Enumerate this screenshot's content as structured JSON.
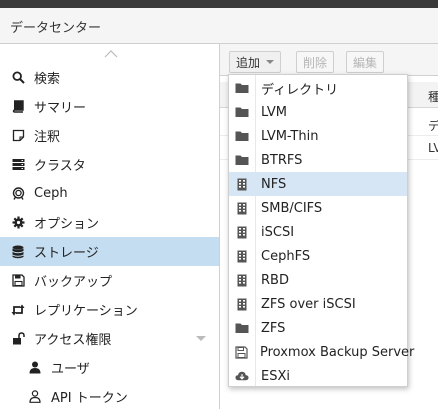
{
  "header": {
    "title": "データセンター"
  },
  "sidebar": {
    "items": [
      {
        "label": "検索",
        "icon": "search-icon"
      },
      {
        "label": "サマリー",
        "icon": "book-icon"
      },
      {
        "label": "注釈",
        "icon": "note-icon"
      },
      {
        "label": "クラスタ",
        "icon": "server-icon"
      },
      {
        "label": "Ceph",
        "icon": "ceph-icon"
      },
      {
        "label": "オプション",
        "icon": "gear-icon"
      },
      {
        "label": "ストレージ",
        "icon": "database-icon"
      },
      {
        "label": "バックアップ",
        "icon": "floppy-icon"
      },
      {
        "label": "レプリケーション",
        "icon": "retweet-icon"
      },
      {
        "label": "アクセス権限",
        "icon": "unlock-icon"
      },
      {
        "label": "ユーザ",
        "icon": "user-icon"
      },
      {
        "label": "API トークン",
        "icon": "user-outline-icon"
      }
    ],
    "selected_index": 6
  },
  "toolbar": {
    "add_label": "追加",
    "delete_label": "削除",
    "edit_label": "編集"
  },
  "grid": {
    "header_partial": "種",
    "rows": [
      "デ",
      "LV"
    ]
  },
  "add_menu": {
    "items": [
      {
        "label": "ディレクトリ",
        "icon": "folder-icon"
      },
      {
        "label": "LVM",
        "icon": "folder-icon"
      },
      {
        "label": "LVM-Thin",
        "icon": "folder-icon"
      },
      {
        "label": "BTRFS",
        "icon": "folder-icon"
      },
      {
        "label": "NFS",
        "icon": "building-icon"
      },
      {
        "label": "SMB/CIFS",
        "icon": "building-icon"
      },
      {
        "label": "iSCSI",
        "icon": "building-icon"
      },
      {
        "label": "CephFS",
        "icon": "building-icon"
      },
      {
        "label": "RBD",
        "icon": "building-icon"
      },
      {
        "label": "ZFS over iSCSI",
        "icon": "building-icon"
      },
      {
        "label": "ZFS",
        "icon": "folder-icon"
      },
      {
        "label": "Proxmox Backup Server",
        "icon": "floppy-outline-icon"
      },
      {
        "label": "ESXi",
        "icon": "cloud-download-icon"
      }
    ],
    "hover_index": 4
  },
  "colors": {
    "selected": "#c4ddf0",
    "menu_hover": "#d6e6f5",
    "icon": "#555555"
  }
}
